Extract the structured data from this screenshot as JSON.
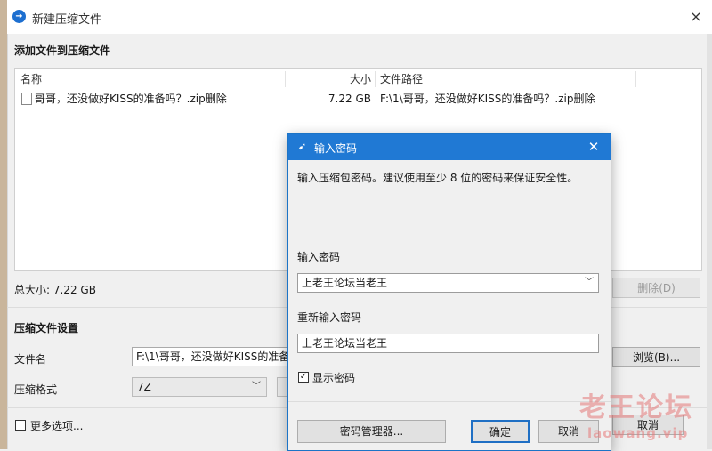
{
  "window": {
    "title": "新建压缩文件",
    "close_icon": "×"
  },
  "files_section": {
    "title": "添加文件到压缩文件",
    "columns": [
      "名称",
      "大小",
      "文件路径"
    ],
    "rows": [
      {
        "name": "哥哥，还没做好KISS的准备吗？.zip删除",
        "size": "7.22 GB",
        "path": "F:\\1\\哥哥，还没做好KISS的准备吗？.zip删除"
      }
    ],
    "total_size": "总大小: 7.22 GB",
    "delete_button": "删除(D)"
  },
  "settings": {
    "title": "压缩文件设置",
    "filename_label": "文件名",
    "filename_value": "F:\\1\\哥哥，还没做好KISS的准备吗？.zip删除",
    "browse_button": "浏览(B)...",
    "format_label": "压缩格式",
    "format_value": "7Z",
    "more_options": "更多选项...",
    "cancel_button": "取消"
  },
  "dialog": {
    "title": "输入密码",
    "description": "输入压缩包密码。建议使用至少 8 位的密码来保证安全性。",
    "password_label": "输入密码",
    "password_value": "上老王论坛当老王",
    "reenter_label": "重新输入密码",
    "reenter_value": "上老王论坛当老王",
    "show_password_label": "显示密码",
    "show_password_checked": true,
    "manager_button": "密码管理器...",
    "ok_button": "确定",
    "cancel_button": "取消"
  },
  "watermark": {
    "line1": "老王论坛",
    "line2": "laowang.vip"
  },
  "colors": {
    "dialog_titlebar": "#2079d4",
    "background": "#f0f0f0"
  }
}
